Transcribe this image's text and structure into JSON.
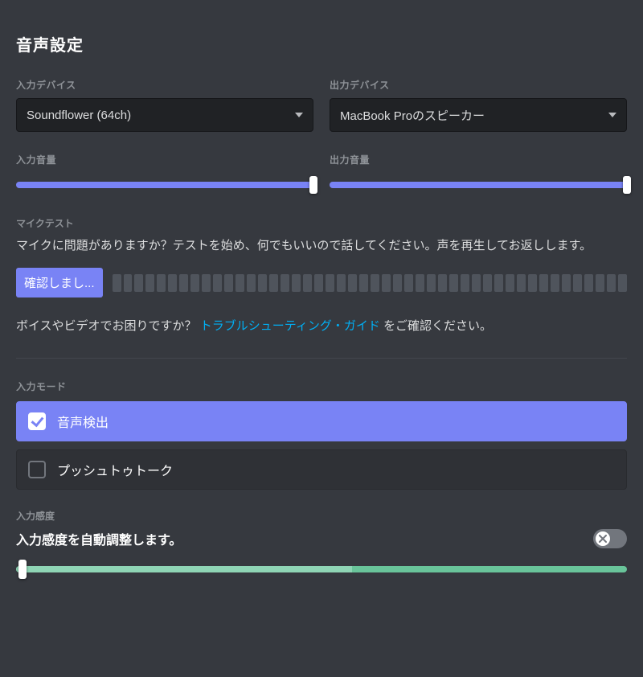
{
  "title": "音声設定",
  "input_device": {
    "label": "入力デバイス",
    "value": "Soundflower (64ch)"
  },
  "output_device": {
    "label": "出力デバイス",
    "value": "MacBook Proのスピーカー"
  },
  "input_volume": {
    "label": "入力音量",
    "percent": 100
  },
  "output_volume": {
    "label": "出力音量",
    "percent": 100
  },
  "mic_test": {
    "label": "マイクテスト",
    "description": "マイクに問題がありますか？テストを始め、何でもいいので話してください。声を再生してお返しします。",
    "button": "確認しまし..."
  },
  "help": {
    "prefix": "ボイスやビデオでお困りですか？ ",
    "link": "トラブルシューティング・ガイド",
    "suffix": " をご確認ください。"
  },
  "input_mode": {
    "label": "入力モード",
    "options": [
      {
        "label": "音声検出",
        "selected": true
      },
      {
        "label": "プッシュトゥトーク",
        "selected": false
      }
    ]
  },
  "sensitivity": {
    "label": "入力感度",
    "auto_text": "入力感度を自動調整します。",
    "auto_enabled": false,
    "split_percent": 55,
    "thumb_percent": 1
  }
}
